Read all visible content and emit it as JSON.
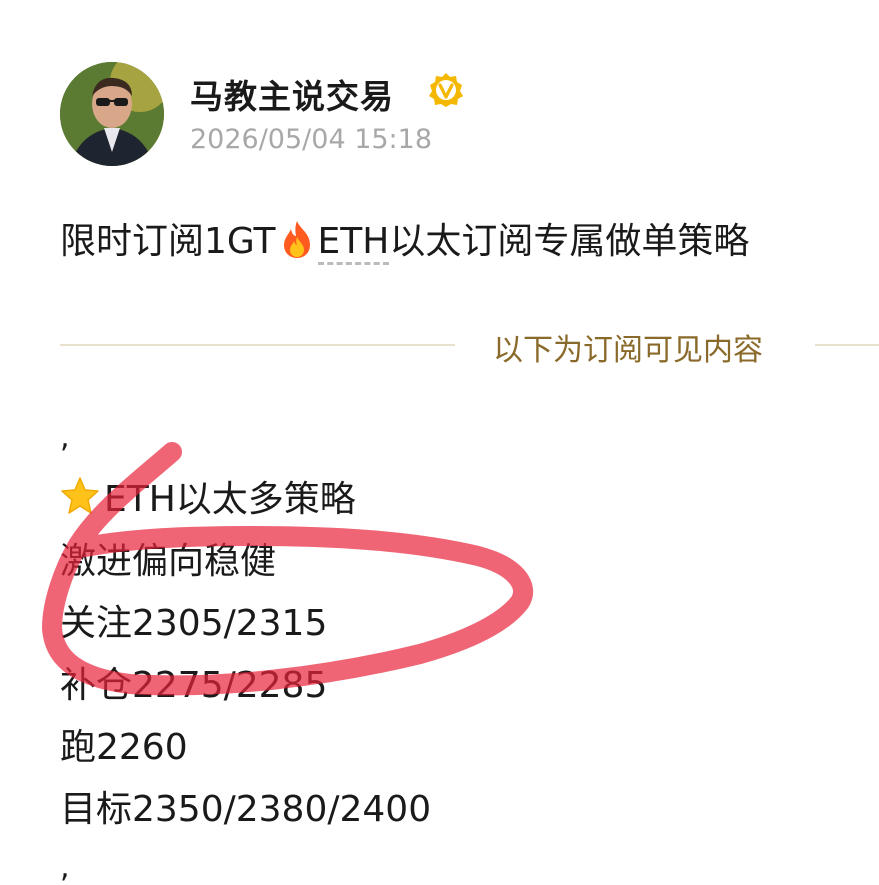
{
  "post": {
    "author_name": "马教主说交易",
    "timestamp": "2026/05/04 15:18",
    "title_prefix": "限时订阅1GT",
    "title_link": "ETH",
    "title_suffix": "以太订阅专属做单策略",
    "divider_text": "以下为订阅可见内容"
  },
  "content": {
    "lead_punct": ",",
    "strategy_title": "ETH以太多策略",
    "style": "激进偏向稳健",
    "watch": "关注2305/2315",
    "add": "补仓2275/2285",
    "stop": "跑2260",
    "target": "目标2350/2380/2400",
    "trail_punct": ","
  },
  "icons": {
    "verified": "verified-badge-icon",
    "fire": "fire-emoji-icon",
    "star": "star-emoji-icon"
  },
  "colors": {
    "accent_gold": "#8a6a2a",
    "verified_yellow": "#f5b800",
    "timestamp_gray": "#a8a8a8",
    "annotation_red": "#e8233a"
  }
}
